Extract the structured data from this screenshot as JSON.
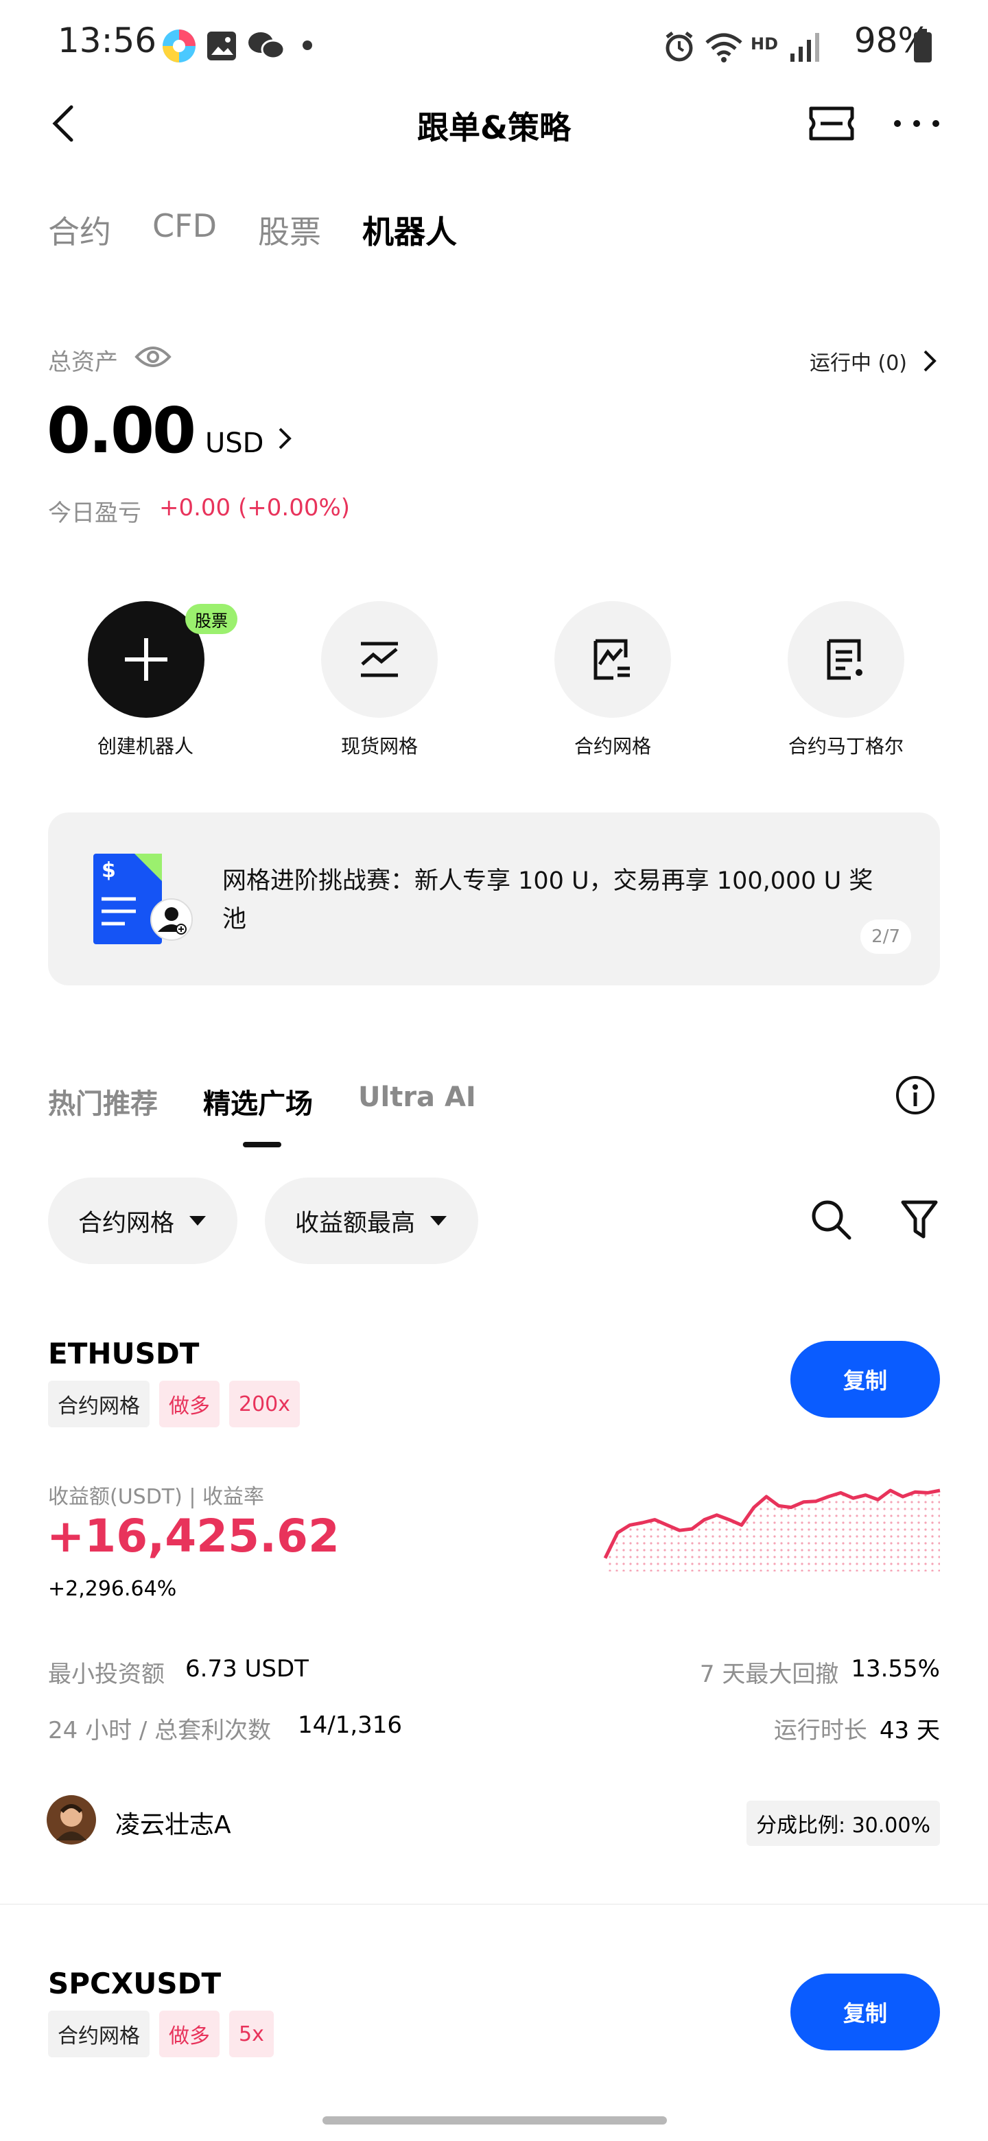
{
  "status_bar": {
    "time": "13:56",
    "hd": "HD",
    "battery": "98%"
  },
  "header": {
    "title": "跟单&策略"
  },
  "top_tabs": [
    "合约",
    "CFD",
    "股票",
    "机器人"
  ],
  "assets": {
    "label": "总资产",
    "value": "0.00",
    "unit": "USD",
    "running": "运行中 (0)",
    "today_label": "今日盈亏",
    "today_value": "+0.00 (+0.00%)"
  },
  "quick_actions": [
    {
      "label": "创建机器人",
      "badge": "股票",
      "icon": "plus-icon"
    },
    {
      "label": "现货网格",
      "icon": "grid-chart-icon"
    },
    {
      "label": "合约网格",
      "icon": "contract-grid-icon"
    },
    {
      "label": "合约马丁格尔",
      "icon": "martingale-icon"
    }
  ],
  "banner": {
    "text": "网格进阶挑战赛：新人专享 100 U，交易再享 100,000 U 奖池",
    "page": "2/7"
  },
  "section_tabs": [
    "热门推荐",
    "精选广场",
    "Ultra AI"
  ],
  "filters": {
    "type": "合约网格",
    "sort": "收益额最高"
  },
  "cards": [
    {
      "symbol": "ETHUSDT",
      "tags": [
        "合约网格",
        "做多",
        "200x"
      ],
      "copy": "复制",
      "profit_label": "收益额(USDT) | 收益率",
      "profit": "+16,425.62",
      "rate": "+2,296.64%",
      "min_invest_label": "最小投资额",
      "min_invest": "6.73 USDT",
      "drawdown_label": "7 天最大回撤",
      "drawdown": "13.55%",
      "arb_label": "24 小时 / 总套利次数",
      "arb": "14/1,316",
      "runtime_label": "运行时长",
      "runtime": "43 天",
      "user": "凌云壮志A",
      "share": "分成比例: 30.00%",
      "spark": [
        0.12,
        0.45,
        0.55,
        0.58,
        0.62,
        0.55,
        0.48,
        0.5,
        0.62,
        0.68,
        0.62,
        0.55,
        0.78,
        0.92,
        0.8,
        0.78,
        0.85,
        0.86,
        0.92,
        0.97,
        0.9,
        0.94,
        0.88,
        1.0,
        0.92,
        0.98,
        0.97,
        1.0
      ]
    },
    {
      "symbol": "SPCXUSDT",
      "tags": [
        "合约网格",
        "做多",
        "5x"
      ],
      "copy": "复制"
    }
  ],
  "colors": {
    "accent": "#0a5cff",
    "profit": "#e8335b",
    "badge": "#9bf06e"
  }
}
